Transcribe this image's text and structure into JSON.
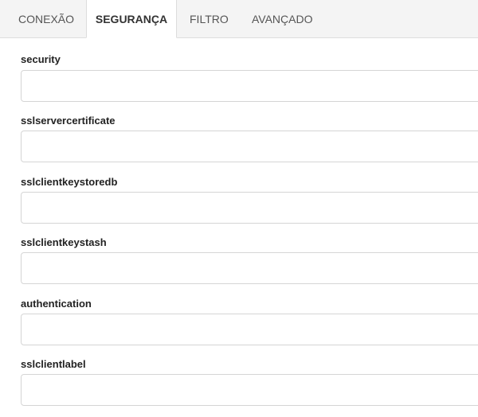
{
  "tabs": [
    {
      "label": "CONEXÃO",
      "active": false
    },
    {
      "label": "SEGURANÇA",
      "active": true
    },
    {
      "label": "FILTRO",
      "active": false
    },
    {
      "label": "AVANÇADO",
      "active": false
    }
  ],
  "form": {
    "fields": [
      {
        "label": "security",
        "value": ""
      },
      {
        "label": "sslservercertificate",
        "value": ""
      },
      {
        "label": "sslclientkeystoredb",
        "value": ""
      },
      {
        "label": "sslclientkeystash",
        "value": ""
      },
      {
        "label": "authentication",
        "value": ""
      },
      {
        "label": "sslclientlabel",
        "value": ""
      }
    ]
  }
}
